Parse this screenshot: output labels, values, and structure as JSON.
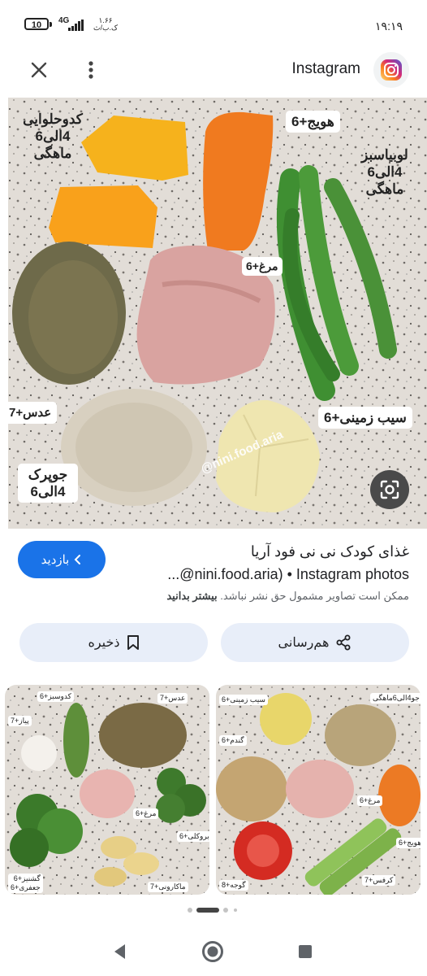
{
  "status_bar": {
    "battery": "10",
    "network": "4G",
    "speed_top": "۱.۶۶",
    "speed_bottom": "ک.ب/ث",
    "time": "۱۹:۱۹"
  },
  "viewer": {
    "source_label": "Instagram",
    "icons": {
      "close": "close-icon",
      "more": "more-vert-icon",
      "logo": "instagram-icon",
      "lens": "lens-icon"
    },
    "photo_labels": {
      "pumpkin": "کدوحلوایی\n4الی6\nماهگی",
      "carrot": "هویج+6",
      "beans": "لوبیاسبز\n4الی6\nماهگی",
      "chicken": "مرغ+6",
      "lentil": "عدس+7",
      "potato": "سیب زمینی+6",
      "oat": "جوپرک\n4الی6"
    },
    "watermark": "@nini.food.aria"
  },
  "result": {
    "title_line1": "غذای کودک نی نی فود آریا",
    "title_line2": "...@nini.food.aria) • Instagram photos",
    "copyright": "ممکن است تصاویر مشمول حق نشر نباشد.",
    "learn_more": "بیشتر بدانید",
    "visit_label": "بازدید",
    "share_label": "هم‌رسانی",
    "save_label": "ذخیره"
  },
  "thumbnails": {
    "left": {
      "labels": {
        "cucumber": "کدوسبز+6",
        "lentil": "عدس+7",
        "onion": "پیاز+7",
        "chicken": "مرغ+6",
        "broccoli": "کلم بروکلی+6",
        "parsley": "گشنیز+6\nجعفری+6",
        "pasta": "ماکارونی+7"
      }
    },
    "right": {
      "labels": {
        "potato": "سیب زمینی+6",
        "barley": "جو4الی6ماهگی",
        "wheat": "گندم+6",
        "chicken": "مرغ+6",
        "carrot": "هویج+6",
        "tomato": "گوجه+8",
        "celery": "کرفس+7"
      }
    }
  },
  "pager": {
    "pages": 4,
    "active": 1
  },
  "nav": {
    "back": "back-icon",
    "home": "home-icon",
    "recents": "recents-icon"
  },
  "colors": {
    "accent": "#1a73e8",
    "pill": "#e8eef9"
  }
}
